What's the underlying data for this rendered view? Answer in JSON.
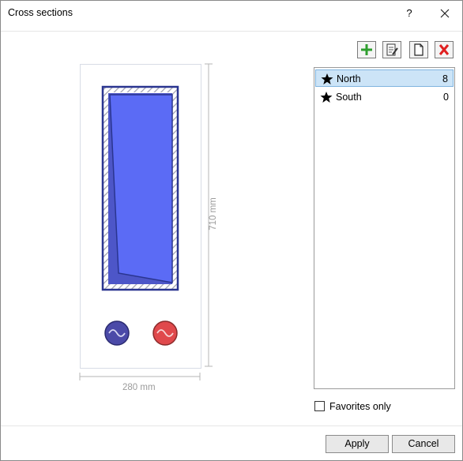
{
  "window": {
    "title": "Cross sections"
  },
  "titlebar": {
    "help": "?"
  },
  "preview": {
    "width_label": "280 mm",
    "height_label": "710 mm"
  },
  "sections": [
    {
      "name": "North",
      "count": "8",
      "selected": true,
      "icon": "star-icon"
    },
    {
      "name": "South",
      "count": "0",
      "selected": false,
      "icon": "star-icon"
    }
  ],
  "filter": {
    "favorites_only_label": "Favorites only",
    "checked": false
  },
  "footer": {
    "apply_label": "Apply",
    "cancel_label": "Cancel"
  },
  "colors": {
    "section_fill": "#5b6bf5",
    "section_edge": "#2a3590",
    "rebar_cold": "#4b4aa8",
    "rebar_hot": "#e0494c",
    "selection": "#cce4f7"
  }
}
